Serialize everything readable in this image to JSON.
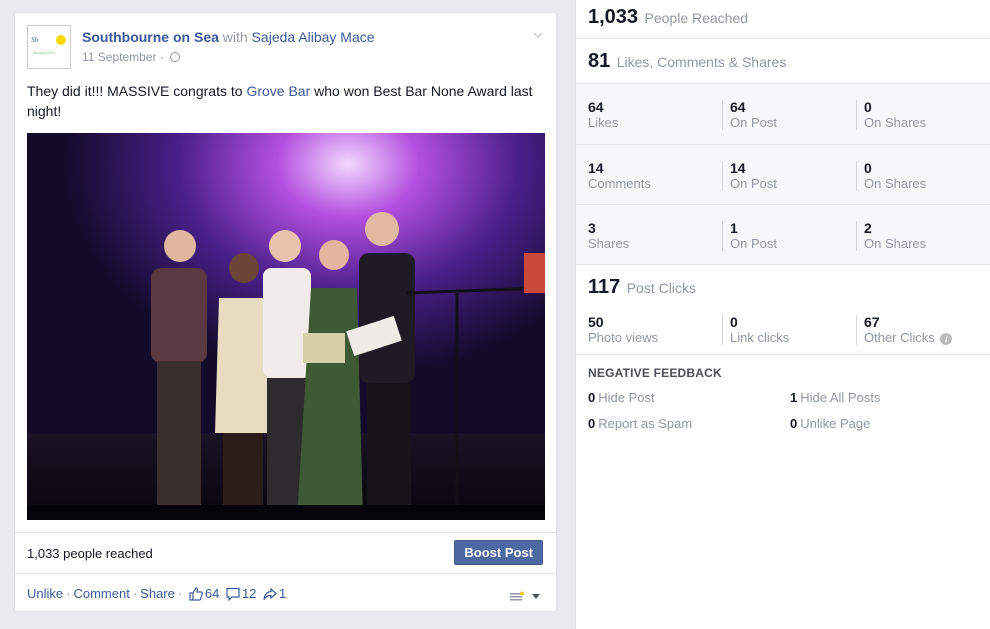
{
  "post": {
    "page_name": "Southbourne on Sea",
    "with_text": "with",
    "tagged_person": "Sajeda Alibay Mace",
    "date": "11 September",
    "text_before": "They did it!!! MASSIVE congrats to ",
    "text_link": "Grove Bar",
    "text_after": " who won Best Bar None Award last night!",
    "reach_text": "1,033 people reached",
    "boost_label": "Boost Post",
    "actions": {
      "unlike": "Unlike",
      "comment": "Comment",
      "share": "Share",
      "separator": "·",
      "likes_count": "64",
      "comments_count": "12",
      "shares_count": "1"
    },
    "icons": [
      "globe-icon",
      "chevron-down-icon",
      "thumbs-up-icon",
      "comment-icon",
      "share-arrow-icon",
      "audience-selector-icon"
    ],
    "colors": {
      "link": "#3b5998",
      "boost_button": "#4e69a2",
      "muted": "#9197a3"
    }
  },
  "stats": {
    "people_reached": {
      "value": "1,033",
      "label": "People Reached"
    },
    "engagement": {
      "value": "81",
      "label": "Likes, Comments & Shares"
    },
    "rows": [
      {
        "cells": [
          {
            "value": "64",
            "label": "Likes"
          },
          {
            "value": "64",
            "label": "On Post"
          },
          {
            "value": "0",
            "label": "On Shares"
          }
        ]
      },
      {
        "cells": [
          {
            "value": "14",
            "label": "Comments"
          },
          {
            "value": "14",
            "label": "On Post"
          },
          {
            "value": "0",
            "label": "On Shares"
          }
        ]
      },
      {
        "cells": [
          {
            "value": "3",
            "label": "Shares"
          },
          {
            "value": "1",
            "label": "On Post"
          },
          {
            "value": "2",
            "label": "On Shares"
          }
        ]
      }
    ],
    "post_clicks": {
      "value": "117",
      "label": "Post Clicks"
    },
    "clicks": [
      {
        "value": "50",
        "label": "Photo views"
      },
      {
        "value": "0",
        "label": "Link clicks"
      },
      {
        "value": "67",
        "label": "Other Clicks"
      }
    ],
    "info_glyph": "i",
    "negative": {
      "title": "NEGATIVE FEEDBACK",
      "items": [
        {
          "value": "0",
          "label": "Hide Post"
        },
        {
          "value": "1",
          "label": "Hide All Posts"
        },
        {
          "value": "0",
          "label": "Report as Spam"
        },
        {
          "value": "0",
          "label": "Unlike Page"
        }
      ]
    }
  }
}
